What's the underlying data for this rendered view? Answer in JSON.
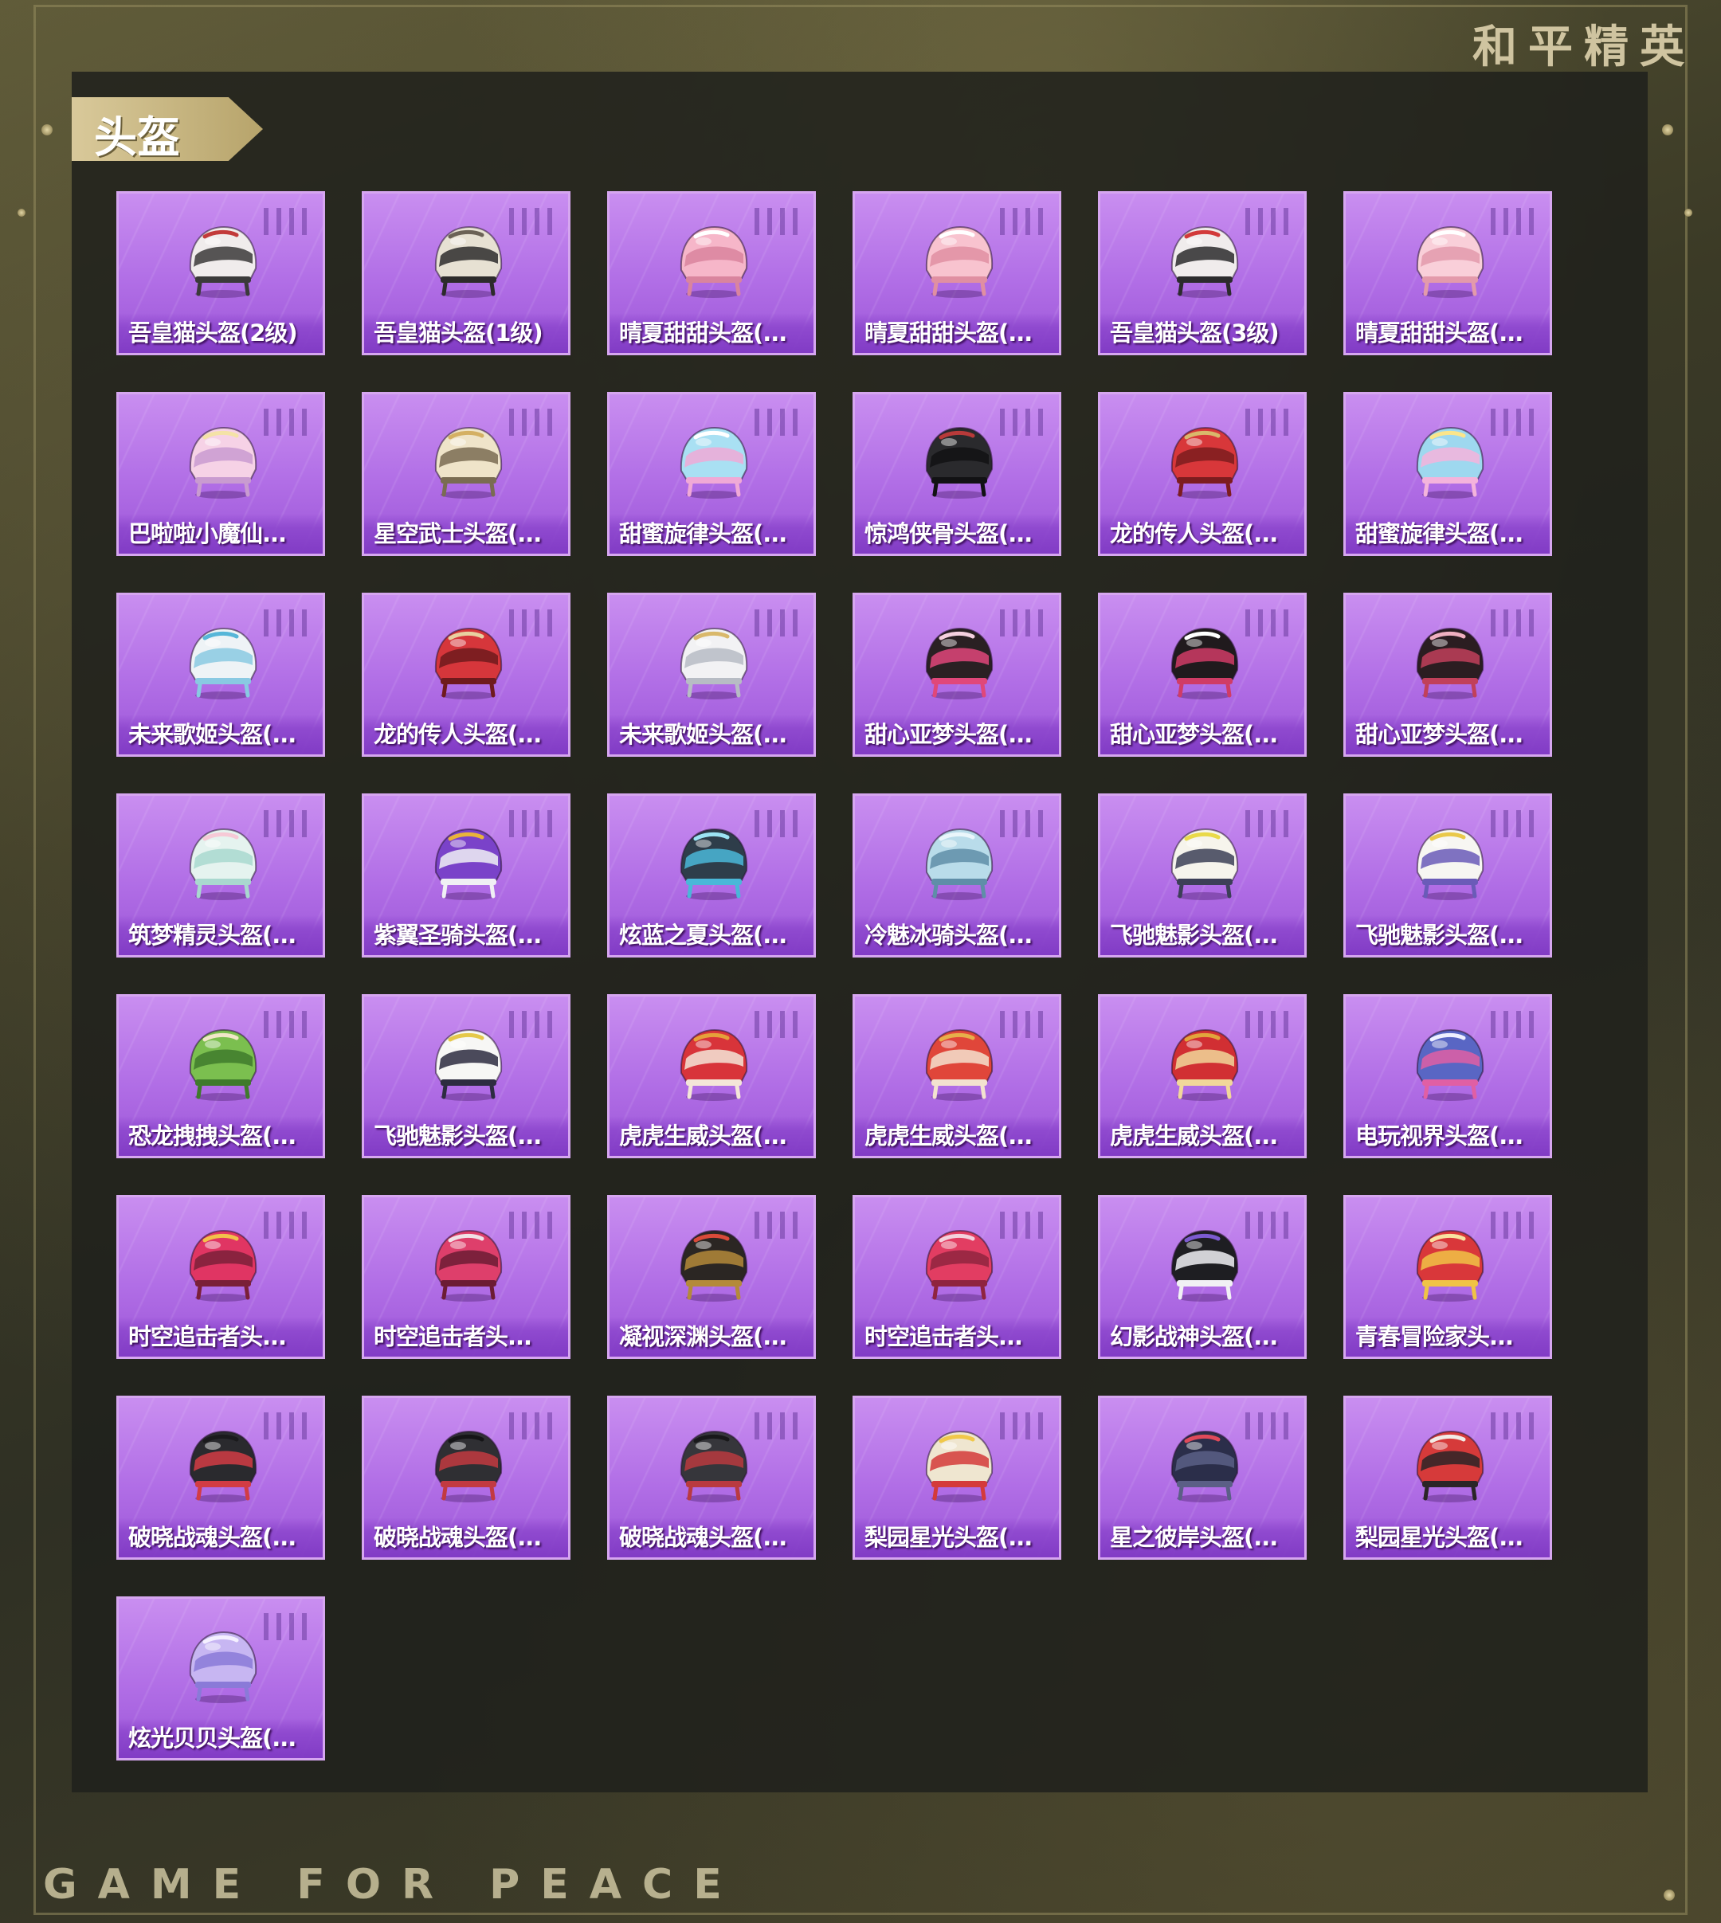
{
  "brand": "和平精英",
  "footer": "GAME FOR PEACE",
  "section": {
    "title": "头盔"
  },
  "colors": {
    "card": "#b16ee6",
    "card_border": "#d6a6f0",
    "tag": "#c9b783"
  },
  "items": [
    {
      "label": "吾皇猫头盔(2级)",
      "icon": "cat-helmet-icon",
      "c1": "#f0ecec",
      "c2": "#3b3a3a",
      "accent": "#c23a3a"
    },
    {
      "label": "吾皇猫头盔(1级)",
      "icon": "cat-helmet-icon",
      "c1": "#e7e1d3",
      "c2": "#2d2b2b",
      "accent": "#6b6256"
    },
    {
      "label": "晴夏甜甜头盔(...",
      "icon": "pink-helmet-icon",
      "c1": "#f6b6c9",
      "c2": "#d9849e",
      "accent": "#ffffff"
    },
    {
      "label": "晴夏甜甜头盔(...",
      "icon": "pink-helmet-icon",
      "c1": "#f8c3cf",
      "c2": "#e08fa2",
      "accent": "#ffffff"
    },
    {
      "label": "吾皇猫头盔(3级)",
      "icon": "cat-helmet-icon",
      "c1": "#f0ecec",
      "c2": "#2c2b2d",
      "accent": "#d23a3a"
    },
    {
      "label": "晴夏甜甜头盔(...",
      "icon": "pink-helmet-icon",
      "c1": "#f9cfd9",
      "c2": "#e39aab",
      "accent": "#ffffff"
    },
    {
      "label": "巴啦啦小魔仙...",
      "icon": "fairy-helmet-icon",
      "c1": "#f6d2e6",
      "c2": "#c99bd0",
      "accent": "#f4e2a6"
    },
    {
      "label": "星空武士头盔(...",
      "icon": "samurai-helmet-icon",
      "c1": "#efe4c9",
      "c2": "#7a6c52",
      "accent": "#d4b063"
    },
    {
      "label": "甜蜜旋律头盔(...",
      "icon": "melody-helmet-icon",
      "c1": "#a9e0f3",
      "c2": "#f0a9d6",
      "accent": "#ffffff"
    },
    {
      "label": "惊鸿侠骨头盔(...",
      "icon": "black-helmet-icon",
      "c1": "#2a2a2d",
      "c2": "#121214",
      "accent": "#b83a3a"
    },
    {
      "label": "龙的传人头盔(...",
      "icon": "dragon-helmet-icon",
      "c1": "#d8373a",
      "c2": "#7d1c1f",
      "accent": "#d9b86b"
    },
    {
      "label": "甜蜜旋律头盔(...",
      "icon": "melody-helmet-icon",
      "c1": "#9ed8ef",
      "c2": "#f4b4dc",
      "accent": "#fbe58a"
    },
    {
      "label": "未来歌姬头盔(...",
      "icon": "diva-helmet-icon",
      "c1": "#eef3f6",
      "c2": "#89c9e2",
      "accent": "#56b6d8"
    },
    {
      "label": "龙的传人头盔(...",
      "icon": "dragon-helmet-icon",
      "c1": "#d6363b",
      "c2": "#6f1a1d",
      "accent": "#e8d0a0"
    },
    {
      "label": "未来歌姬头盔(...",
      "icon": "diva-helmet-icon",
      "c1": "#f2f2f4",
      "c2": "#b7bcc4",
      "accent": "#d9b86b"
    },
    {
      "label": "甜心亚梦头盔(...",
      "icon": "sweet-helmet-icon",
      "c1": "#2a2023",
      "c2": "#e0477a",
      "accent": "#f5d0df"
    },
    {
      "label": "甜心亚梦头盔(...",
      "icon": "sweet-helmet-icon",
      "c1": "#201a1d",
      "c2": "#d03c66",
      "accent": "#ffffff"
    },
    {
      "label": "甜心亚梦头盔(...",
      "icon": "sweet-helmet-icon",
      "c1": "#2b1d21",
      "c2": "#c1405a",
      "accent": "#f0b0c0"
    },
    {
      "label": "筑梦精灵头盔(...",
      "icon": "elf-helmet-icon",
      "c1": "#e5f3ef",
      "c2": "#a9d8cf",
      "accent": "#f6c9d6"
    },
    {
      "label": "紫翼圣骑头盔(...",
      "icon": "paladin-helmet-icon",
      "c1": "#7a42c9",
      "c2": "#f0f0f4",
      "accent": "#e8b33a"
    },
    {
      "label": "炫蓝之夏头盔(...",
      "icon": "summer-helmet-icon",
      "c1": "#2e3d4a",
      "c2": "#4ab7d8",
      "accent": "#9ce3f3"
    },
    {
      "label": "冷魅冰骑头盔(...",
      "icon": "ice-helmet-icon",
      "c1": "#b9dcea",
      "c2": "#5f8ea8",
      "accent": "#eaf6fb"
    },
    {
      "label": "飞驰魅影头盔(...",
      "icon": "racer-helmet-icon",
      "c1": "#f6f4ec",
      "c2": "#3c3f57",
      "accent": "#e9d94a"
    },
    {
      "label": "飞驰魅影头盔(...",
      "icon": "racer-helmet-icon",
      "c1": "#f7f6f2",
      "c2": "#6a5bb8",
      "accent": "#e9c84a"
    },
    {
      "label": "恐龙拽拽头盔(...",
      "icon": "dino-helmet-icon",
      "c1": "#7bbf4f",
      "c2": "#3f7a2c",
      "accent": "#f1e7c8"
    },
    {
      "label": "飞驰魅影头盔(...",
      "icon": "racer-helmet-icon",
      "c1": "#f7f7f5",
      "c2": "#2d2c40",
      "accent": "#e5c84a"
    },
    {
      "label": "虎虎生威头盔(...",
      "icon": "tiger-helmet-icon",
      "c1": "#d8343a",
      "c2": "#f4e6d8",
      "accent": "#e5a13a"
    },
    {
      "label": "虎虎生威头盔(...",
      "icon": "tiger-helmet-icon",
      "c1": "#e0463a",
      "c2": "#f3e2cf",
      "accent": "#e6b04a"
    },
    {
      "label": "虎虎生威头盔(...",
      "icon": "tiger-helmet-icon",
      "c1": "#d12f33",
      "c2": "#f1d79a",
      "accent": "#e1a53c"
    },
    {
      "label": "电玩视界头盔(...",
      "icon": "gamer-helmet-icon",
      "c1": "#5966c4",
      "c2": "#e05fa4",
      "accent": "#eef0ff"
    },
    {
      "label": "时空追击者头...",
      "icon": "mecha-helmet-icon",
      "c1": "#e03563",
      "c2": "#7a2038",
      "accent": "#f2c14a"
    },
    {
      "label": "时空追击者头...",
      "icon": "mecha-helmet-icon",
      "c1": "#de3f6b",
      "c2": "#6c1c34",
      "accent": "#f0e2e6"
    },
    {
      "label": "凝视深渊头盔(...",
      "icon": "abyss-helmet-icon",
      "c1": "#2b2623",
      "c2": "#b48a3a",
      "accent": "#d94a3a"
    },
    {
      "label": "时空追击者头...",
      "icon": "mecha-helmet-icon",
      "c1": "#e23d62",
      "c2": "#8f243f",
      "accent": "#f3d2dc"
    },
    {
      "label": "幻影战神头盔(...",
      "icon": "phantom-helmet-icon",
      "c1": "#1e1e22",
      "c2": "#f1f1f4",
      "accent": "#7c5bd0"
    },
    {
      "label": "青春冒险家头...",
      "icon": "adventurer-helmet-icon",
      "c1": "#d9373a",
      "c2": "#f0c346",
      "accent": "#f8e3a0"
    },
    {
      "label": "破晓战魂头盔(...",
      "icon": "spike-helmet-icon",
      "c1": "#2a2a2e",
      "c2": "#d23c44",
      "accent": "#1a1a1c"
    },
    {
      "label": "破晓战魂头盔(...",
      "icon": "spike-helmet-icon",
      "c1": "#2f2f33",
      "c2": "#c23a41",
      "accent": "#151517"
    },
    {
      "label": "破晓战魂头盔(...",
      "icon": "spike-helmet-icon",
      "c1": "#36363b",
      "c2": "#b93a40",
      "accent": "#18181a"
    },
    {
      "label": "梨园星光头盔(...",
      "icon": "opera-helmet-icon",
      "c1": "#efe6d0",
      "c2": "#d43a3a",
      "accent": "#f0c84a"
    },
    {
      "label": "星之彼岸头盔(...",
      "icon": "star-helmet-icon",
      "c1": "#2b2e4a",
      "c2": "#5b5f86",
      "accent": "#e04a5a"
    },
    {
      "label": "梨园星光头盔(...",
      "icon": "opera-helmet-icon",
      "c1": "#d63a3a",
      "c2": "#2b2527",
      "accent": "#f1ece6"
    },
    {
      "label": "炫光贝贝头盔(...",
      "icon": "glow-helmet-icon",
      "c1": "#c7b6f2",
      "c2": "#8a7ad8",
      "accent": "#f4f0ff"
    }
  ]
}
